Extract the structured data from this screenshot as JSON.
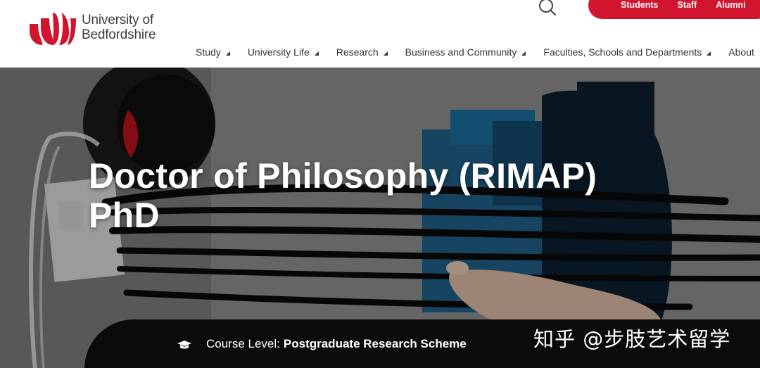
{
  "brand": {
    "logo_line1": "University of",
    "logo_line2": "Bedfordshire",
    "accent": "#d2152e"
  },
  "audience_links": [
    "Students",
    "Staff",
    "Alumni"
  ],
  "nav": [
    {
      "label": "Study"
    },
    {
      "label": "University Life"
    },
    {
      "label": "Research"
    },
    {
      "label": "Business and Community"
    },
    {
      "label": "Faculties, Schools and Departments"
    },
    {
      "label": "About"
    }
  ],
  "search": {
    "icon": "search-icon"
  },
  "hero": {
    "title_line1": "Doctor of Philosophy (RIMAP)",
    "title_line2": "PhD"
  },
  "course": {
    "icon": "graduation-cap-icon",
    "level_label": "Course Level:",
    "level_value": "Postgraduate Research Scheme"
  },
  "watermark": "知乎 @步肢艺术留学"
}
